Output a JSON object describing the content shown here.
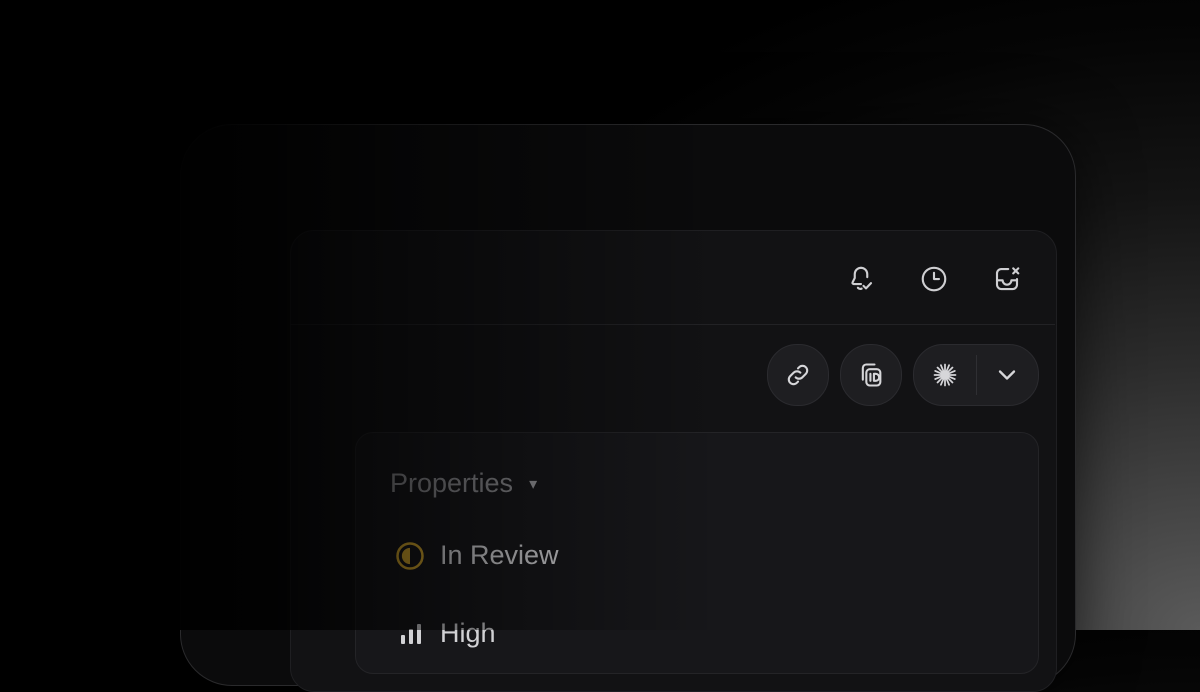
{
  "header": {
    "icons": [
      "bell-check-icon",
      "clock-icon",
      "inbox-close-icon"
    ]
  },
  "toolbar": {
    "buttons": [
      "link-icon",
      "copy-id-icon",
      "ai-spark-icon",
      "chevron-down-icon"
    ]
  },
  "properties": {
    "label": "Properties",
    "caret": "▾",
    "status": {
      "label": "In Review",
      "color": "#d4a72c"
    },
    "priority": {
      "label": "High",
      "icon": "bar-chart-icon"
    }
  }
}
